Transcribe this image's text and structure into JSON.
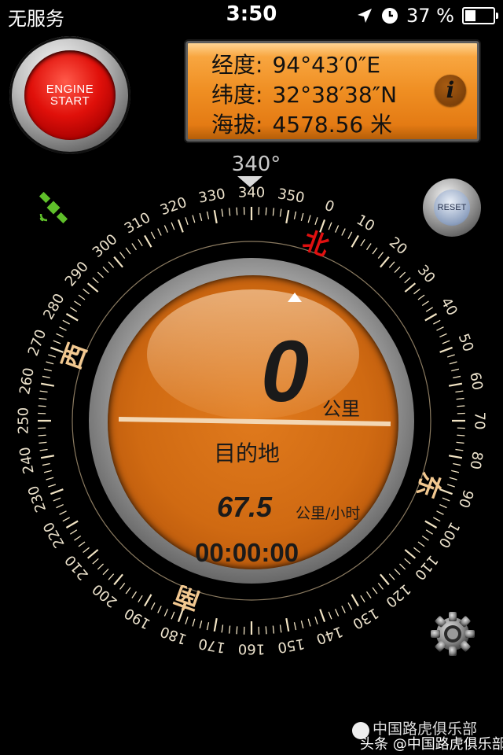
{
  "status_bar": {
    "carrier": "无服务",
    "time": "3:50",
    "battery_percent": "37 %",
    "battery_level": 0.37
  },
  "engine_button": {
    "line1": "ENGINE",
    "line2": "START"
  },
  "coordinates": {
    "longitude_label": "经度:",
    "longitude_value": "94°43′0″E",
    "latitude_label": "纬度:",
    "latitude_value": "32°38′38″N",
    "altitude_label": "海拔:",
    "altitude_value": "4578.56 米",
    "info_label": "i"
  },
  "heading": {
    "value": "340°",
    "degrees": 340
  },
  "reset_button": {
    "label": "RESET"
  },
  "compass": {
    "tick_labels": [
      "0",
      "10",
      "20",
      "30",
      "40",
      "50",
      "60",
      "70",
      "80",
      "90",
      "100",
      "110",
      "120",
      "130",
      "140",
      "150",
      "160",
      "170",
      "180",
      "190",
      "200",
      "210",
      "220",
      "230",
      "240",
      "250",
      "260",
      "270",
      "280",
      "290",
      "300",
      "310",
      "320",
      "330",
      "340",
      "350"
    ],
    "cardinals": {
      "north": "北",
      "east": "东",
      "south": "南",
      "west": "西"
    },
    "north_color": "#e01010",
    "cardinal_color": "#f2c890"
  },
  "dial": {
    "distance_value": "0",
    "distance_unit": "公里",
    "destination_label": "目的地",
    "speed_value": "67.5",
    "speed_unit": "公里/小时",
    "timer": "00:00:00"
  },
  "watermark": {
    "line1": "中国路虎俱乐部",
    "line2": "头条 @中国路虎俱乐部"
  }
}
